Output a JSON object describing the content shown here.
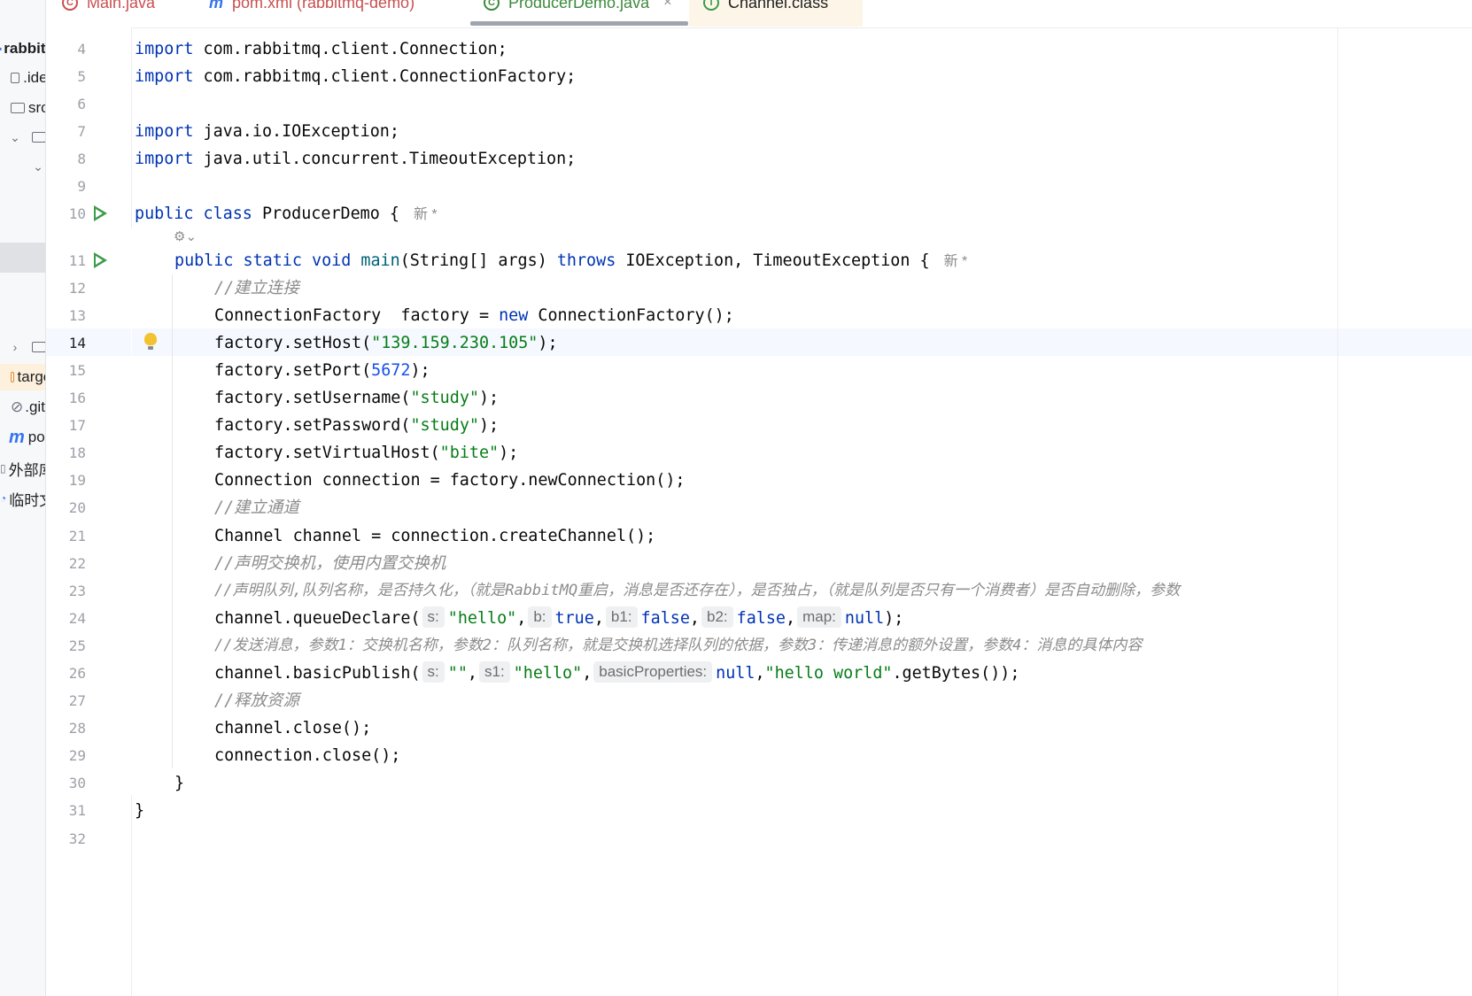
{
  "tabs": [
    {
      "label": "Main.java",
      "icon": "class-icon"
    },
    {
      "label": "pom.xml (rabbitmq-demo)",
      "icon": "maven-icon"
    },
    {
      "label": "ProducerDemo.java",
      "icon": "class-icon",
      "active": true,
      "close": "×"
    },
    {
      "label": "Channel.class",
      "icon": "interface-icon"
    }
  ],
  "sidebar": {
    "items": [
      {
        "label": "rabbitmq-demo"
      },
      {
        "label": ".idea"
      },
      {
        "label": "src"
      },
      {
        "label": ""
      },
      {
        "label": ""
      },
      {
        "label": ""
      },
      {
        "label": "target"
      },
      {
        "label": ".gitignore"
      },
      {
        "label": "pom.xml"
      },
      {
        "label": "外部库"
      },
      {
        "label": "临时文件和控制台"
      }
    ]
  },
  "editor": {
    "inlay_author": "新 *",
    "lines": [
      {
        "n": "4",
        "text": "import com.rabbitmq.client.Connection;"
      },
      {
        "n": "5",
        "text": "import com.rabbitmq.client.ConnectionFactory;"
      },
      {
        "n": "6",
        "text": ""
      },
      {
        "n": "7",
        "text": "import java.io.IOException;"
      },
      {
        "n": "8",
        "text": "import java.util.concurrent.TimeoutException;"
      },
      {
        "n": "9",
        "text": ""
      },
      {
        "n": "10",
        "text": "public class ProducerDemo {"
      },
      {
        "n": "11",
        "text": "public static void main(String[] args) throws IOException, TimeoutException {"
      },
      {
        "n": "12",
        "text": "//建立连接"
      },
      {
        "n": "13",
        "text": "ConnectionFactory  factory = new ConnectionFactory();"
      },
      {
        "n": "14",
        "text": "factory.setHost(\"139.159.230.105\");"
      },
      {
        "n": "15",
        "text": "factory.setPort(5672);"
      },
      {
        "n": "16",
        "text": "factory.setUsername(\"study\");"
      },
      {
        "n": "17",
        "text": "factory.setPassword(\"study\");"
      },
      {
        "n": "18",
        "text": "factory.setVirtualHost(\"bite\");"
      },
      {
        "n": "19",
        "text": "Connection connection = factory.newConnection();"
      },
      {
        "n": "20",
        "text": "//建立通道"
      },
      {
        "n": "21",
        "text": "Channel channel = connection.createChannel();"
      },
      {
        "n": "22",
        "text": "//声明交换机，使用内置交换机"
      },
      {
        "n": "23",
        "text": "//声明队列,队列名称，是否持久化，（就是RabbitMQ重启，消息是否还存在），是否独占，（就是队列是否只有一个消费者）是否自动删除，参数"
      },
      {
        "n": "24",
        "text": "channel.queueDeclare(s: \"hello\", b: true, b1: false, b2: false, map: null);"
      },
      {
        "n": "25",
        "text": "//发送消息，参数1：交换机名称，参数2：队列名称，就是交换机选择队列的依据，参数3：传递消息的额外设置，参数4：消息的具体内容"
      },
      {
        "n": "26",
        "text": "channel.basicPublish(s: \"\", s1: \"hello\", basicProperties: null,\"hello world\".getBytes());"
      },
      {
        "n": "27",
        "text": "//释放资源"
      },
      {
        "n": "28",
        "text": "channel.close();"
      },
      {
        "n": "29",
        "text": "connection.close();"
      },
      {
        "n": "30",
        "text": "}"
      },
      {
        "n": "31",
        "text": "}"
      },
      {
        "n": "32",
        "text": ""
      }
    ]
  },
  "colors": {
    "keyword": "#0033b3",
    "string": "#067d17",
    "number": "#1750eb",
    "method_decl": "#00627a",
    "comment": "#8c8c8c",
    "run_gutter": "#3b9c4a",
    "active_tab": "#3b8a3b"
  }
}
